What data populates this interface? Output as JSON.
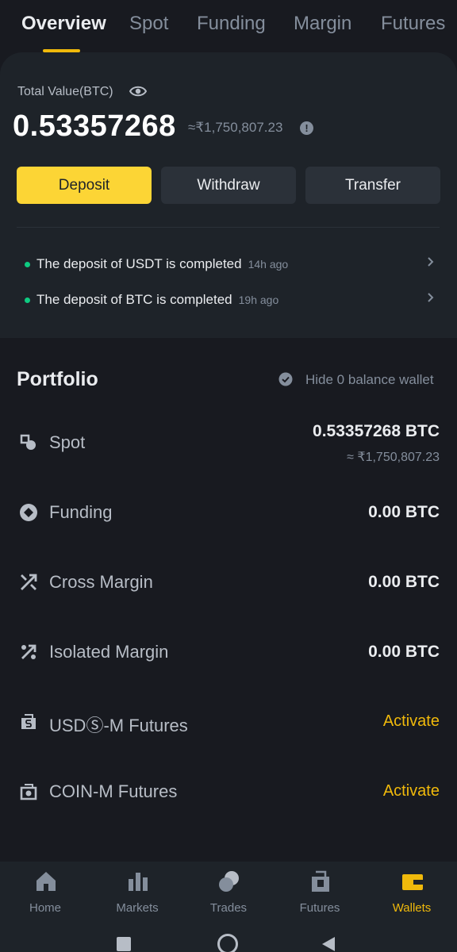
{
  "tabs": [
    {
      "label": "Overview"
    },
    {
      "label": "Spot"
    },
    {
      "label": "Funding"
    },
    {
      "label": "Margin"
    },
    {
      "label": "Futures"
    }
  ],
  "summary": {
    "total_label": "Total Value(BTC)",
    "total_btc": "0.53357268",
    "total_inr": "≈₹1,750,807.23",
    "buttons": {
      "deposit": "Deposit",
      "withdraw": "Withdraw",
      "transfer": "Transfer"
    },
    "notices": [
      {
        "message": "The deposit of USDT is completed",
        "time": "14h ago"
      },
      {
        "message": "The deposit of BTC is completed",
        "time": "19h ago"
      }
    ]
  },
  "portfolio": {
    "title": "Portfolio",
    "hide_label": "Hide 0 balance wallet",
    "rows": [
      {
        "label": "Spot",
        "value": "0.53357268 BTC",
        "sub": "≈ ₹1,750,807.23",
        "icon": "spot-icon"
      },
      {
        "label": "Funding",
        "value": "0.00 BTC",
        "icon": "funding-icon"
      },
      {
        "label": "Cross Margin",
        "value": "0.00 BTC",
        "icon": "cross-margin-icon"
      },
      {
        "label": "Isolated Margin",
        "value": "0.00 BTC",
        "icon": "isolated-margin-icon"
      },
      {
        "label": "USDⓈ-M Futures",
        "activate": "Activate",
        "icon": "usd-futures-icon"
      },
      {
        "label": "COIN-M Futures",
        "activate": "Activate",
        "icon": "coin-futures-icon"
      }
    ]
  },
  "bottom_nav": [
    {
      "label": "Home",
      "icon": "home-icon"
    },
    {
      "label": "Markets",
      "icon": "markets-icon"
    },
    {
      "label": "Trades",
      "icon": "trades-icon"
    },
    {
      "label": "Futures",
      "icon": "futures-icon"
    },
    {
      "label": "Wallets",
      "icon": "wallet-icon",
      "active": true
    }
  ],
  "colors": {
    "background": "#181a20",
    "card": "#1e2329",
    "accent": "#f0b90b",
    "deposit_button": "#fcd535",
    "success_dot": "#0ecb81"
  }
}
